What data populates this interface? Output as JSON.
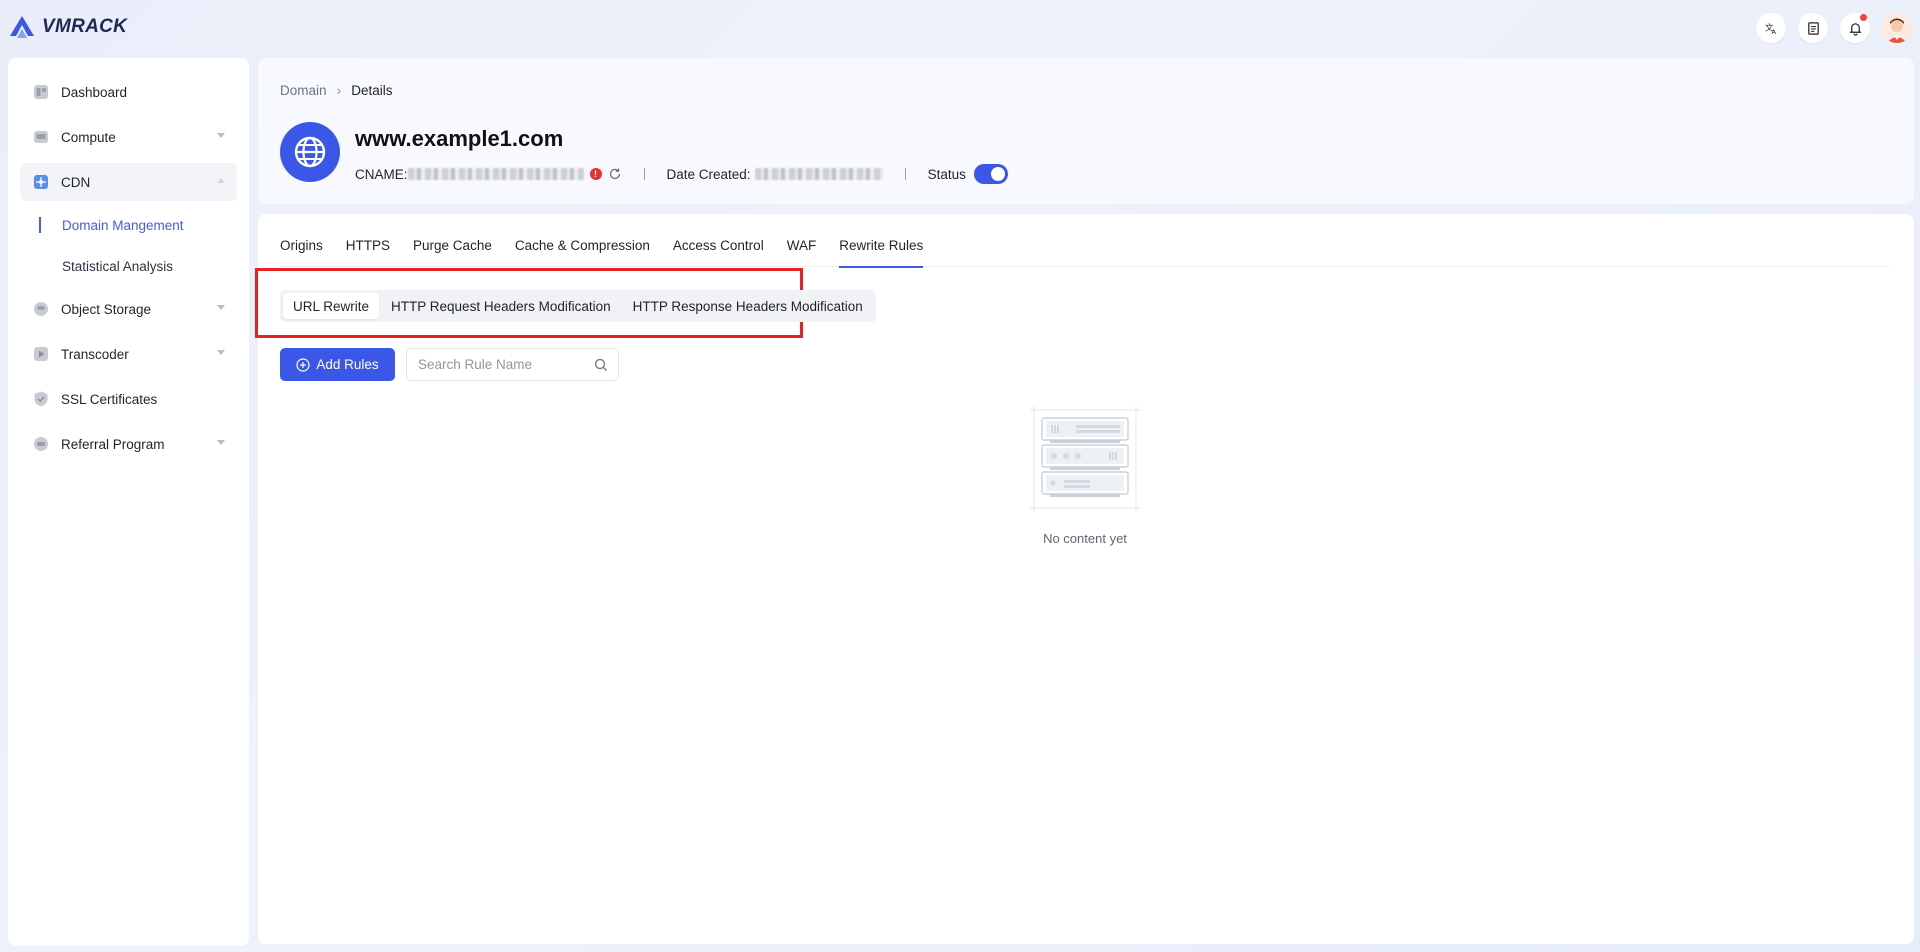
{
  "app": {
    "logo_text": "VMRACK"
  },
  "topbar": {
    "icons": [
      "translate-icon",
      "document-icon",
      "bell-icon"
    ],
    "notification_dot_color": "#f5413b"
  },
  "sidebar": {
    "items": [
      {
        "label": "Dashboard",
        "icon": "dashboard-icon",
        "has_caret": false
      },
      {
        "label": "Compute",
        "icon": "compute-icon",
        "has_caret": true
      },
      {
        "label": "CDN",
        "icon": "cdn-icon",
        "has_caret": true,
        "expanded": true,
        "active": true
      },
      {
        "label": "Domain Mangement",
        "sub": true,
        "active": true
      },
      {
        "label": "Statistical Analysis",
        "sub": true
      },
      {
        "label": "Object Storage",
        "icon": "storage-icon",
        "has_caret": true
      },
      {
        "label": "Transcoder",
        "icon": "transcoder-icon",
        "has_caret": true
      },
      {
        "label": "SSL Certificates",
        "icon": "shield-icon",
        "has_caret": false
      },
      {
        "label": "Referral Program",
        "icon": "referral-icon",
        "has_caret": true
      }
    ]
  },
  "header": {
    "breadcrumb": {
      "parent": "Domain",
      "current": "Details"
    },
    "domain": "www.example1.com",
    "cname_label": "CNAME:",
    "date_created_label": "Date Created:",
    "status_label": "Status",
    "status_on": true
  },
  "tabs": [
    "Origins",
    "HTTPS",
    "Purge Cache",
    "Cache & Compression",
    "Access Control",
    "WAF",
    "Rewrite Rules"
  ],
  "active_tab": "Rewrite Rules",
  "subtabs": [
    "URL Rewrite",
    "HTTP Request Headers Modification",
    "HTTP Response Headers Modification"
  ],
  "active_subtab": "URL Rewrite",
  "toolbar": {
    "add_label": "Add Rules",
    "search_placeholder": "Search Rule Name"
  },
  "empty_state": {
    "text": "No content yet"
  },
  "colors": {
    "accent": "#3a57e8",
    "highlight": "#e8201e"
  }
}
